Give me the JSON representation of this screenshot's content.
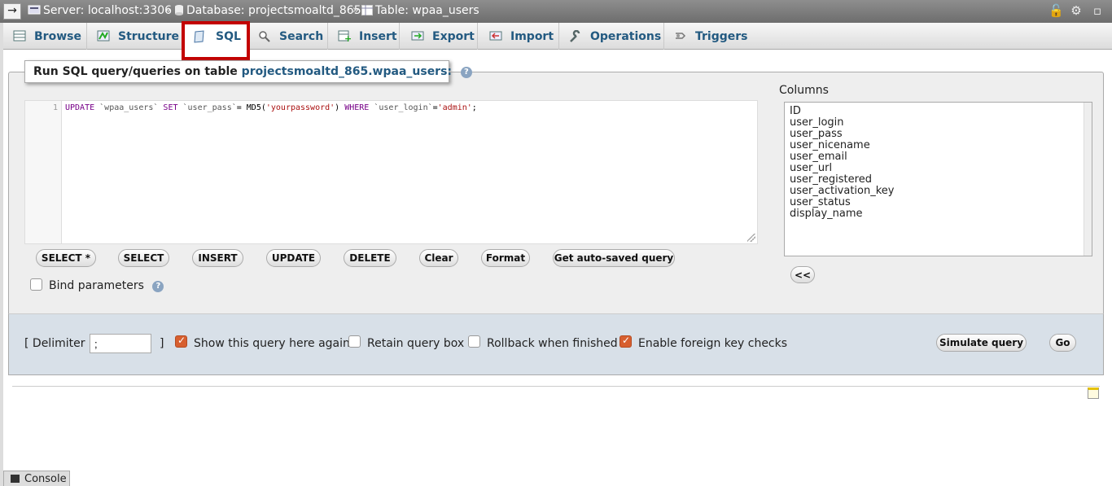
{
  "breadcrumb": {
    "server": "Server: localhost:3306",
    "database": "Database: projectsmoaltd_865",
    "table": "Table: wpaa_users",
    "separator": "»"
  },
  "tabs": [
    {
      "label": "Browse",
      "icon": "browse-icon"
    },
    {
      "label": "Structure",
      "icon": "structure-icon"
    },
    {
      "label": "SQL",
      "icon": "sql-icon",
      "active": true
    },
    {
      "label": "Search",
      "icon": "search-icon"
    },
    {
      "label": "Insert",
      "icon": "insert-icon"
    },
    {
      "label": "Export",
      "icon": "export-icon"
    },
    {
      "label": "Import",
      "icon": "import-icon"
    },
    {
      "label": "Operations",
      "icon": "wrench-icon"
    },
    {
      "label": "Triggers",
      "icon": "triggers-icon"
    }
  ],
  "query_panel": {
    "legend_prefix": "Run SQL query/queries on table",
    "legend_table": "projectsmoaltd_865.wpaa_users:",
    "line_number": "1",
    "query": {
      "p1": "UPDATE ",
      "p2": "`wpaa_users`",
      "p3": " SET ",
      "p4": "`user_pass`",
      "p5": "= MD5(",
      "p6": "'yourpassword'",
      "p7": ") ",
      "p8": "WHERE",
      "p9": " ",
      "p10": "`user_login`",
      "p11": "=",
      "p12": "'admin'",
      "p13": ";"
    }
  },
  "buttons": {
    "select_star": "SELECT *",
    "select": "SELECT",
    "insert": "INSERT",
    "update": "UPDATE",
    "delete": "DELETE",
    "clear": "Clear",
    "format": "Format",
    "autosaved": "Get auto-saved query",
    "insert_columns": "<<",
    "simulate": "Simulate query",
    "go": "Go"
  },
  "bind_parameters": {
    "label": "Bind parameters",
    "checked": false
  },
  "columns": {
    "title": "Columns",
    "items": [
      "ID",
      "user_login",
      "user_pass",
      "user_nicename",
      "user_email",
      "user_url",
      "user_registered",
      "user_activation_key",
      "user_status",
      "display_name"
    ]
  },
  "options": {
    "delimiter_open": "[ Delimiter",
    "delimiter_value": ";",
    "delimiter_close": "]",
    "show_query": {
      "label": "Show this query here again",
      "checked": true
    },
    "retain_box": {
      "label": "Retain query box",
      "checked": false
    },
    "rollback": {
      "label": "Rollback when finished",
      "checked": false
    },
    "foreign_keys": {
      "label": "Enable foreign key checks",
      "checked": true
    }
  },
  "console": {
    "label": "Console"
  },
  "colors": {
    "accent": "#235a81",
    "highlight": "#c30000",
    "checkbox_on": "#d75f2f"
  }
}
